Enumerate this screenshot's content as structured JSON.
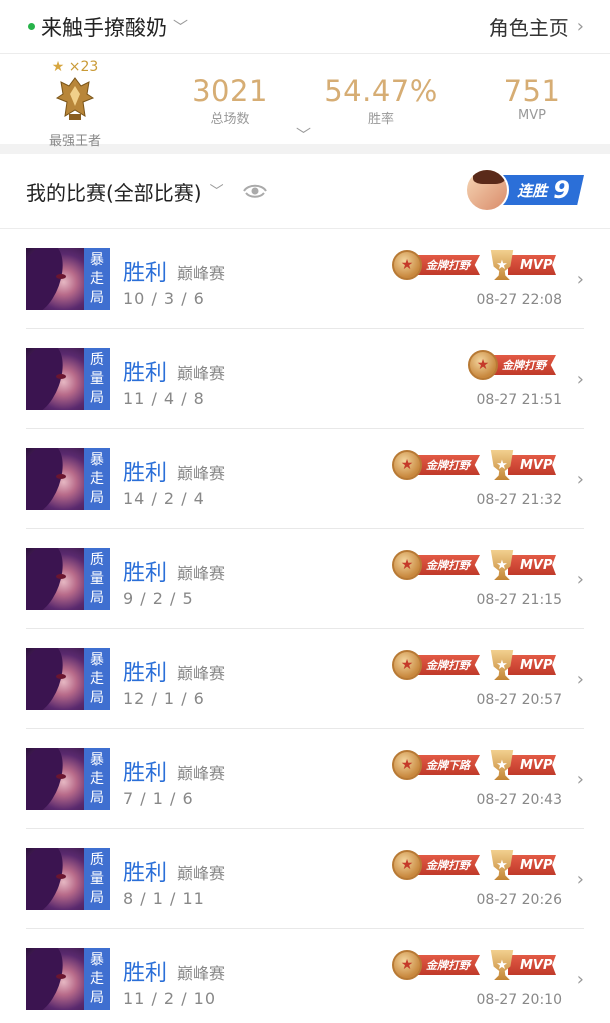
{
  "header": {
    "player_name": "来触手撩酸奶",
    "role_link": "角色主页",
    "dropdown_arrow": "﹀",
    "right_arrow": "›"
  },
  "rank": {
    "star_glyph": "★",
    "stars": "×23",
    "name": "最强王者"
  },
  "stats": [
    {
      "value": "3021",
      "label": "总场数"
    },
    {
      "value": "54.47%",
      "label": "胜率"
    },
    {
      "value": "751",
      "label": "MVP"
    }
  ],
  "expand_arrow": "﹀",
  "section": {
    "title": "我的比赛(全部比赛)",
    "dropdown_arrow": "﹀",
    "streak_label": "连胜",
    "streak_count": "9"
  },
  "matches": [
    {
      "mode_line1": "暴",
      "mode_line2": "走",
      "mode_line3": "局",
      "result": "胜利",
      "type": "巅峰赛",
      "kda": "10 / 3 / 6",
      "gold_badge": "金牌打野",
      "mvp": "MVP",
      "time": "08-27 22:08"
    },
    {
      "mode_line1": "质",
      "mode_line2": "量",
      "mode_line3": "局",
      "result": "胜利",
      "type": "巅峰赛",
      "kda": "11 / 4 / 8",
      "gold_badge": "金牌打野",
      "mvp": "",
      "time": "08-27 21:51"
    },
    {
      "mode_line1": "暴",
      "mode_line2": "走",
      "mode_line3": "局",
      "result": "胜利",
      "type": "巅峰赛",
      "kda": "14 / 2 / 4",
      "gold_badge": "金牌打野",
      "mvp": "MVP",
      "time": "08-27 21:32"
    },
    {
      "mode_line1": "质",
      "mode_line2": "量",
      "mode_line3": "局",
      "result": "胜利",
      "type": "巅峰赛",
      "kda": "9 / 2 / 5",
      "gold_badge": "金牌打野",
      "mvp": "MVP",
      "time": "08-27 21:15"
    },
    {
      "mode_line1": "暴",
      "mode_line2": "走",
      "mode_line3": "局",
      "result": "胜利",
      "type": "巅峰赛",
      "kda": "12 / 1 / 6",
      "gold_badge": "金牌打野",
      "mvp": "MVP",
      "time": "08-27 20:57"
    },
    {
      "mode_line1": "暴",
      "mode_line2": "走",
      "mode_line3": "局",
      "result": "胜利",
      "type": "巅峰赛",
      "kda": "7 / 1 / 6",
      "gold_badge": "金牌下路",
      "mvp": "MVP",
      "time": "08-27 20:43"
    },
    {
      "mode_line1": "质",
      "mode_line2": "量",
      "mode_line3": "局",
      "result": "胜利",
      "type": "巅峰赛",
      "kda": "8 / 1 / 11",
      "gold_badge": "金牌打野",
      "mvp": "MVP",
      "time": "08-27 20:26"
    },
    {
      "mode_line1": "暴",
      "mode_line2": "走",
      "mode_line3": "局",
      "result": "胜利",
      "type": "巅峰赛",
      "kda": "11 / 2 / 10",
      "gold_badge": "金牌打野",
      "mvp": "MVP",
      "time": "08-27 20:10"
    }
  ],
  "colors": {
    "accent_blue": "#2b6fd8",
    "stat_gold": "#d6ad74",
    "badge_red": "#c03a2a",
    "online_green": "#27b34a"
  }
}
